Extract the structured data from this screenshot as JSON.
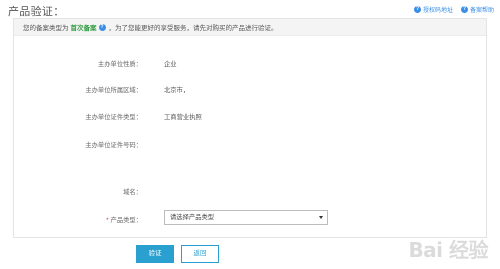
{
  "page": {
    "title": "产品验证："
  },
  "help": [
    {
      "label": "授权码地址",
      "icon": "question-icon"
    },
    {
      "label": "备案帮助",
      "icon": "question-icon"
    }
  ],
  "notice": {
    "prefix": "您的备案类型为",
    "highlight": "首次备案",
    "suffix": "，为了您能更好的享受服务，请先对购买的产品进行验证。"
  },
  "info": [
    {
      "label": "主办单位性质：",
      "value": "企业"
    },
    {
      "label": "主办单位所属区域：",
      "value": "北京市，"
    },
    {
      "label": "主办单位证件类型：",
      "value": "工商营业执照"
    },
    {
      "label": "主办单位证件号码：",
      "value": ""
    }
  ],
  "form": {
    "domain_label": "域名：",
    "product_type_label": "产品类型：",
    "product_type_selected": "请选择产品类型",
    "required_mark": "*"
  },
  "buttons": {
    "verify": "验证",
    "back": "返回"
  },
  "watermark": {
    "text": "Bai 经验"
  },
  "colors": {
    "accent": "#2aa0d0",
    "highlight": "#2f9c40",
    "link": "#3a8ee6",
    "required": "#e03a3a"
  }
}
